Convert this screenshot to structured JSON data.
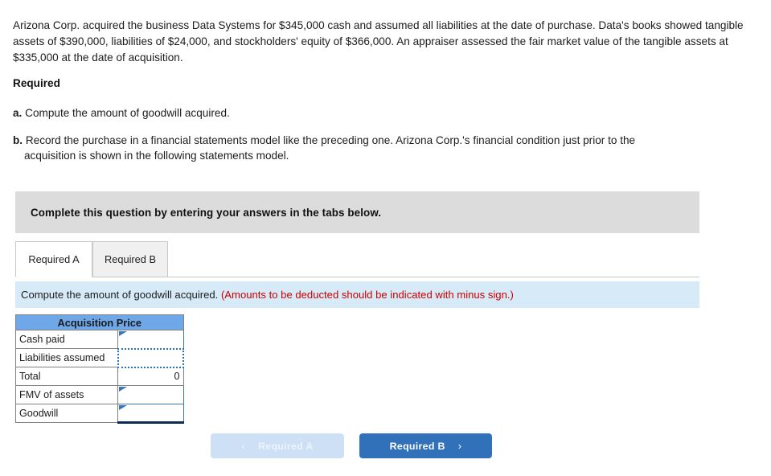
{
  "problem": {
    "text": "Arizona Corp. acquired the business Data Systems for $345,000 cash and assumed all liabilities at the date of purchase. Data's books showed tangible assets of $390,000, liabilities of $24,000, and stockholders' equity of $366,000. An appraiser assessed the fair market value of the tangible assets at $335,000 at the date of acquisition."
  },
  "required": {
    "heading": "Required",
    "items": [
      {
        "marker": "a.",
        "text": "Compute the amount of goodwill acquired."
      },
      {
        "marker": "b.",
        "text": "Record the purchase in a financial statements model like the preceding one. Arizona Corp.'s financial condition just prior to the",
        "text2": "acquisition is shown in the following statements model."
      }
    ]
  },
  "banner": {
    "text": "Complete this question by entering your answers in the tabs below."
  },
  "tabs": [
    {
      "label": "Required A",
      "active": true
    },
    {
      "label": "Required B",
      "active": false
    }
  ],
  "instruction": {
    "main": "Compute the amount of goodwill acquired.",
    "warning": "(Amounts to be deducted should be indicated with minus sign.)"
  },
  "table": {
    "header": "Acquisition Price",
    "rows": [
      {
        "label": "Cash paid",
        "value": "",
        "editable": true,
        "state": "normal"
      },
      {
        "label": "Liabilities assumed",
        "value": "",
        "editable": true,
        "state": "selected"
      },
      {
        "label": "Total",
        "value": "0",
        "editable": false,
        "state": "computed"
      },
      {
        "label": "FMV of assets",
        "value": "",
        "editable": true,
        "state": "normal"
      },
      {
        "label": "Goodwill",
        "value": "",
        "editable": true,
        "state": "total"
      }
    ]
  },
  "nav": {
    "prev_label": "Required A",
    "next_label": "Required B",
    "prev_icon": "chevron-left-icon",
    "next_icon": "chevron-right-icon",
    "prev_chevron": "‹",
    "next_chevron": "›"
  },
  "colors": {
    "table_header": "#6fa8e8",
    "banner_grey": "#dcdcdc",
    "strip_blue": "#d6eaf8",
    "warning_red": "#cc0000",
    "button_blue": "#3071b9",
    "button_disabled": "#cee0f5"
  }
}
